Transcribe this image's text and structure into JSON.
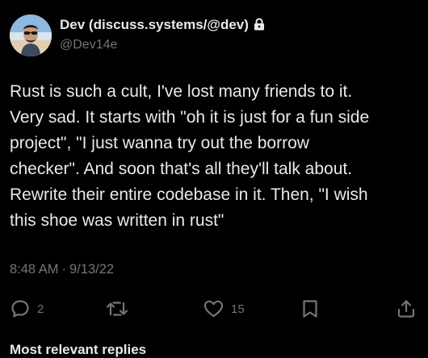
{
  "author": {
    "display_name": "Dev (discuss.systems/@dev)",
    "handle": "@Dev14e",
    "avatar_icon": "profile-photo",
    "protected_icon": "lock-icon"
  },
  "tweet": {
    "text": "Rust is such a cult, I've lost many friends to it.\nVery sad. It starts with \"oh it is just for a fun side\nproject\", \"I just wanna try out the borrow\nchecker\". And soon that's all they'll talk about.\nRewrite their entire codebase in it. Then, \"I wish\nthis shoe was written in rust\"",
    "time": "8:48 AM",
    "separator": "·",
    "date": "9/13/22"
  },
  "actions": {
    "reply": {
      "icon": "reply-icon",
      "count": "2"
    },
    "retweet": {
      "icon": "retweet-icon",
      "count": ""
    },
    "like": {
      "icon": "heart-icon",
      "count": "15"
    },
    "bookmark": {
      "icon": "bookmark-icon"
    },
    "share": {
      "icon": "share-icon"
    }
  },
  "replies_section": {
    "label": "Most relevant replies"
  },
  "colors": {
    "background": "#000000",
    "primary_text": "#e7e9ea",
    "secondary_text": "#71767b"
  }
}
